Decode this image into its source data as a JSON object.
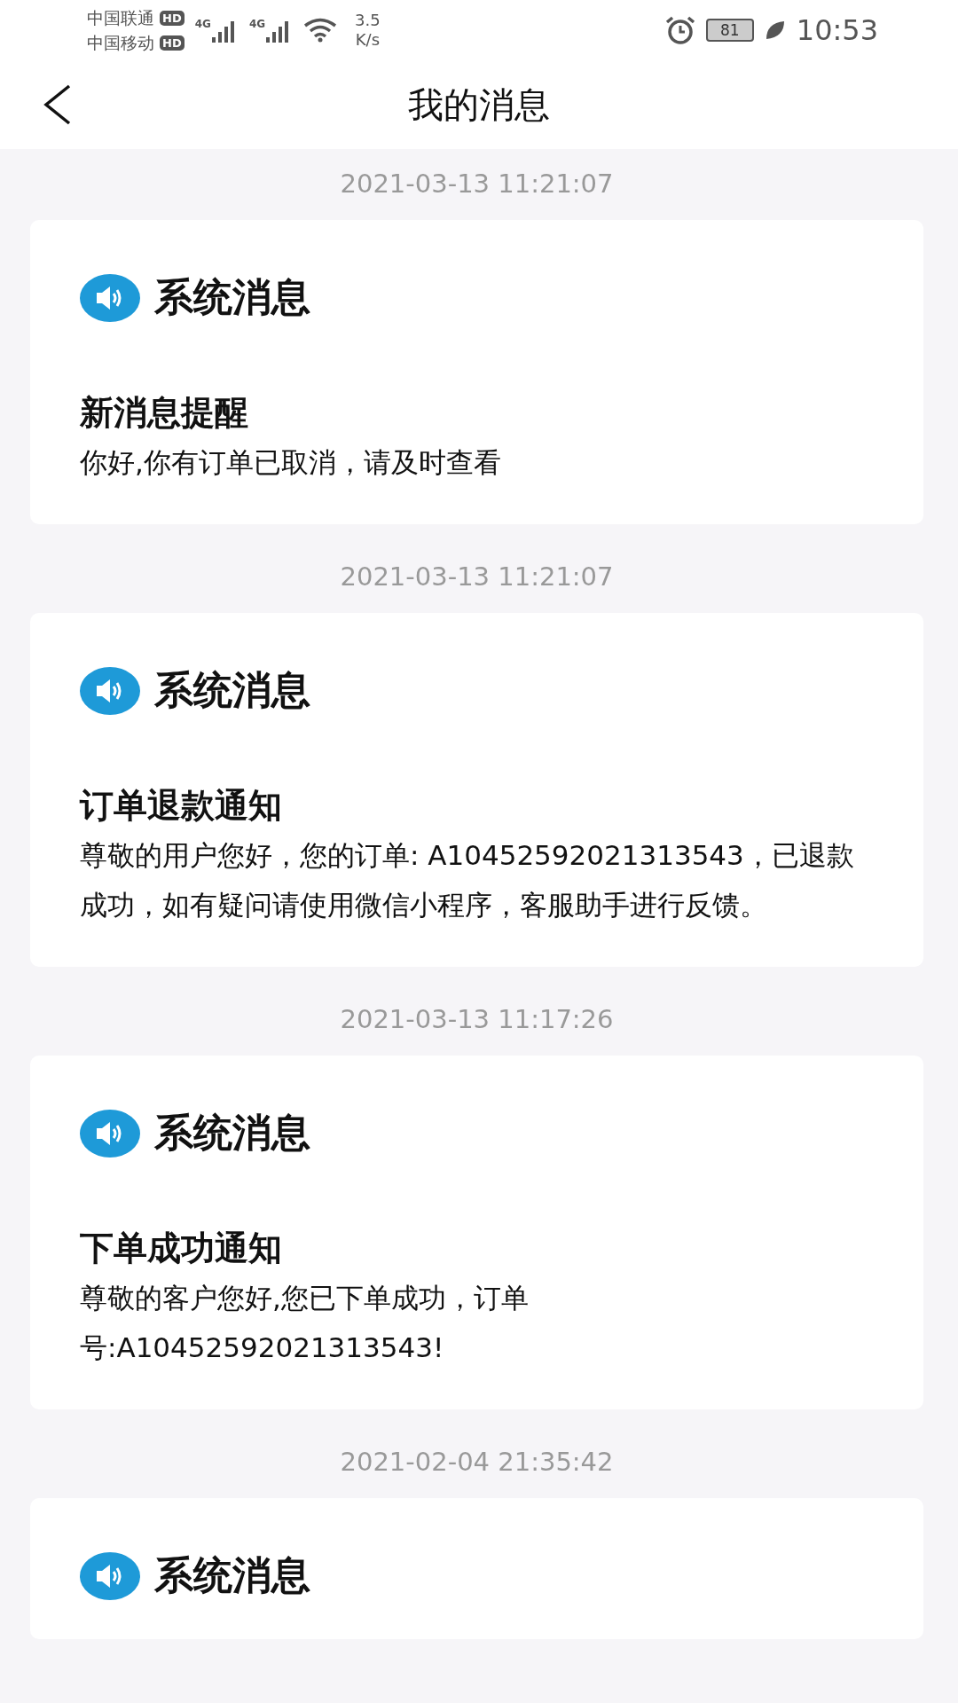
{
  "status_bar": {
    "carriers": [
      {
        "name": "中国联通",
        "badge": "HD"
      },
      {
        "name": "中国移动",
        "badge": "HD"
      }
    ],
    "signals": [
      "4G",
      "4G"
    ],
    "speed": {
      "value": "3.5",
      "unit": "K/s"
    },
    "battery": "81",
    "time": "10:53"
  },
  "nav": {
    "title": "我的消息"
  },
  "messages": [
    {
      "time": "2021-03-13 11:21:07",
      "category": "系统消息",
      "title": "新消息提醒",
      "body": "你好,你有订单已取消，请及时查看"
    },
    {
      "time": "2021-03-13 11:21:07",
      "category": "系统消息",
      "title": "订单退款通知",
      "body": "尊敬的用户您好，您的订单: A10452592021313543，已退款成功，如有疑问请使用微信小程序，客服助手进行反馈。"
    },
    {
      "time": "2021-03-13 11:17:26",
      "category": "系统消息",
      "title": "下单成功通知",
      "body": "尊敬的客户您好,您已下单成功，订单号:A10452592021313543!"
    },
    {
      "time": "2021-02-04 21:35:42",
      "category": "系统消息"
    }
  ]
}
